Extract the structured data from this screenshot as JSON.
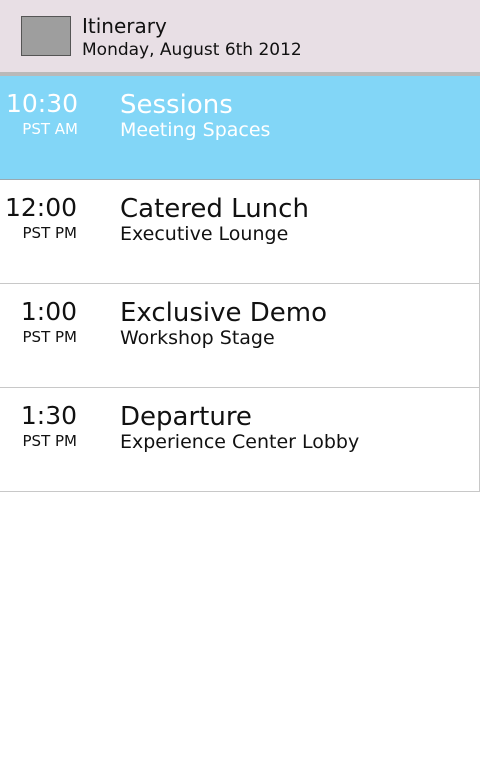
{
  "header": {
    "title": "Itinerary",
    "date": "Monday, August 6th 2012",
    "thumbnail_icon": "image-placeholder-icon"
  },
  "colors": {
    "header_background": "#e8dfe5",
    "selected_row_background": "#82d6f7",
    "selected_text": "#ffffff",
    "text": "#111111",
    "divider": "#c8c8c8"
  },
  "itinerary": [
    {
      "time": "10:30",
      "period": "PST AM",
      "title": "Sessions",
      "location": "Meeting Spaces",
      "selected": true
    },
    {
      "time": "12:00",
      "period": "PST PM",
      "title": "Catered Lunch",
      "location": "Executive Lounge",
      "selected": false
    },
    {
      "time": "1:00",
      "period": "PST PM",
      "title": "Exclusive Demo",
      "location": "Workshop Stage",
      "selected": false
    },
    {
      "time": "1:30",
      "period": "PST PM",
      "title": "Departure",
      "location": "Experience Center Lobby",
      "selected": false
    }
  ]
}
